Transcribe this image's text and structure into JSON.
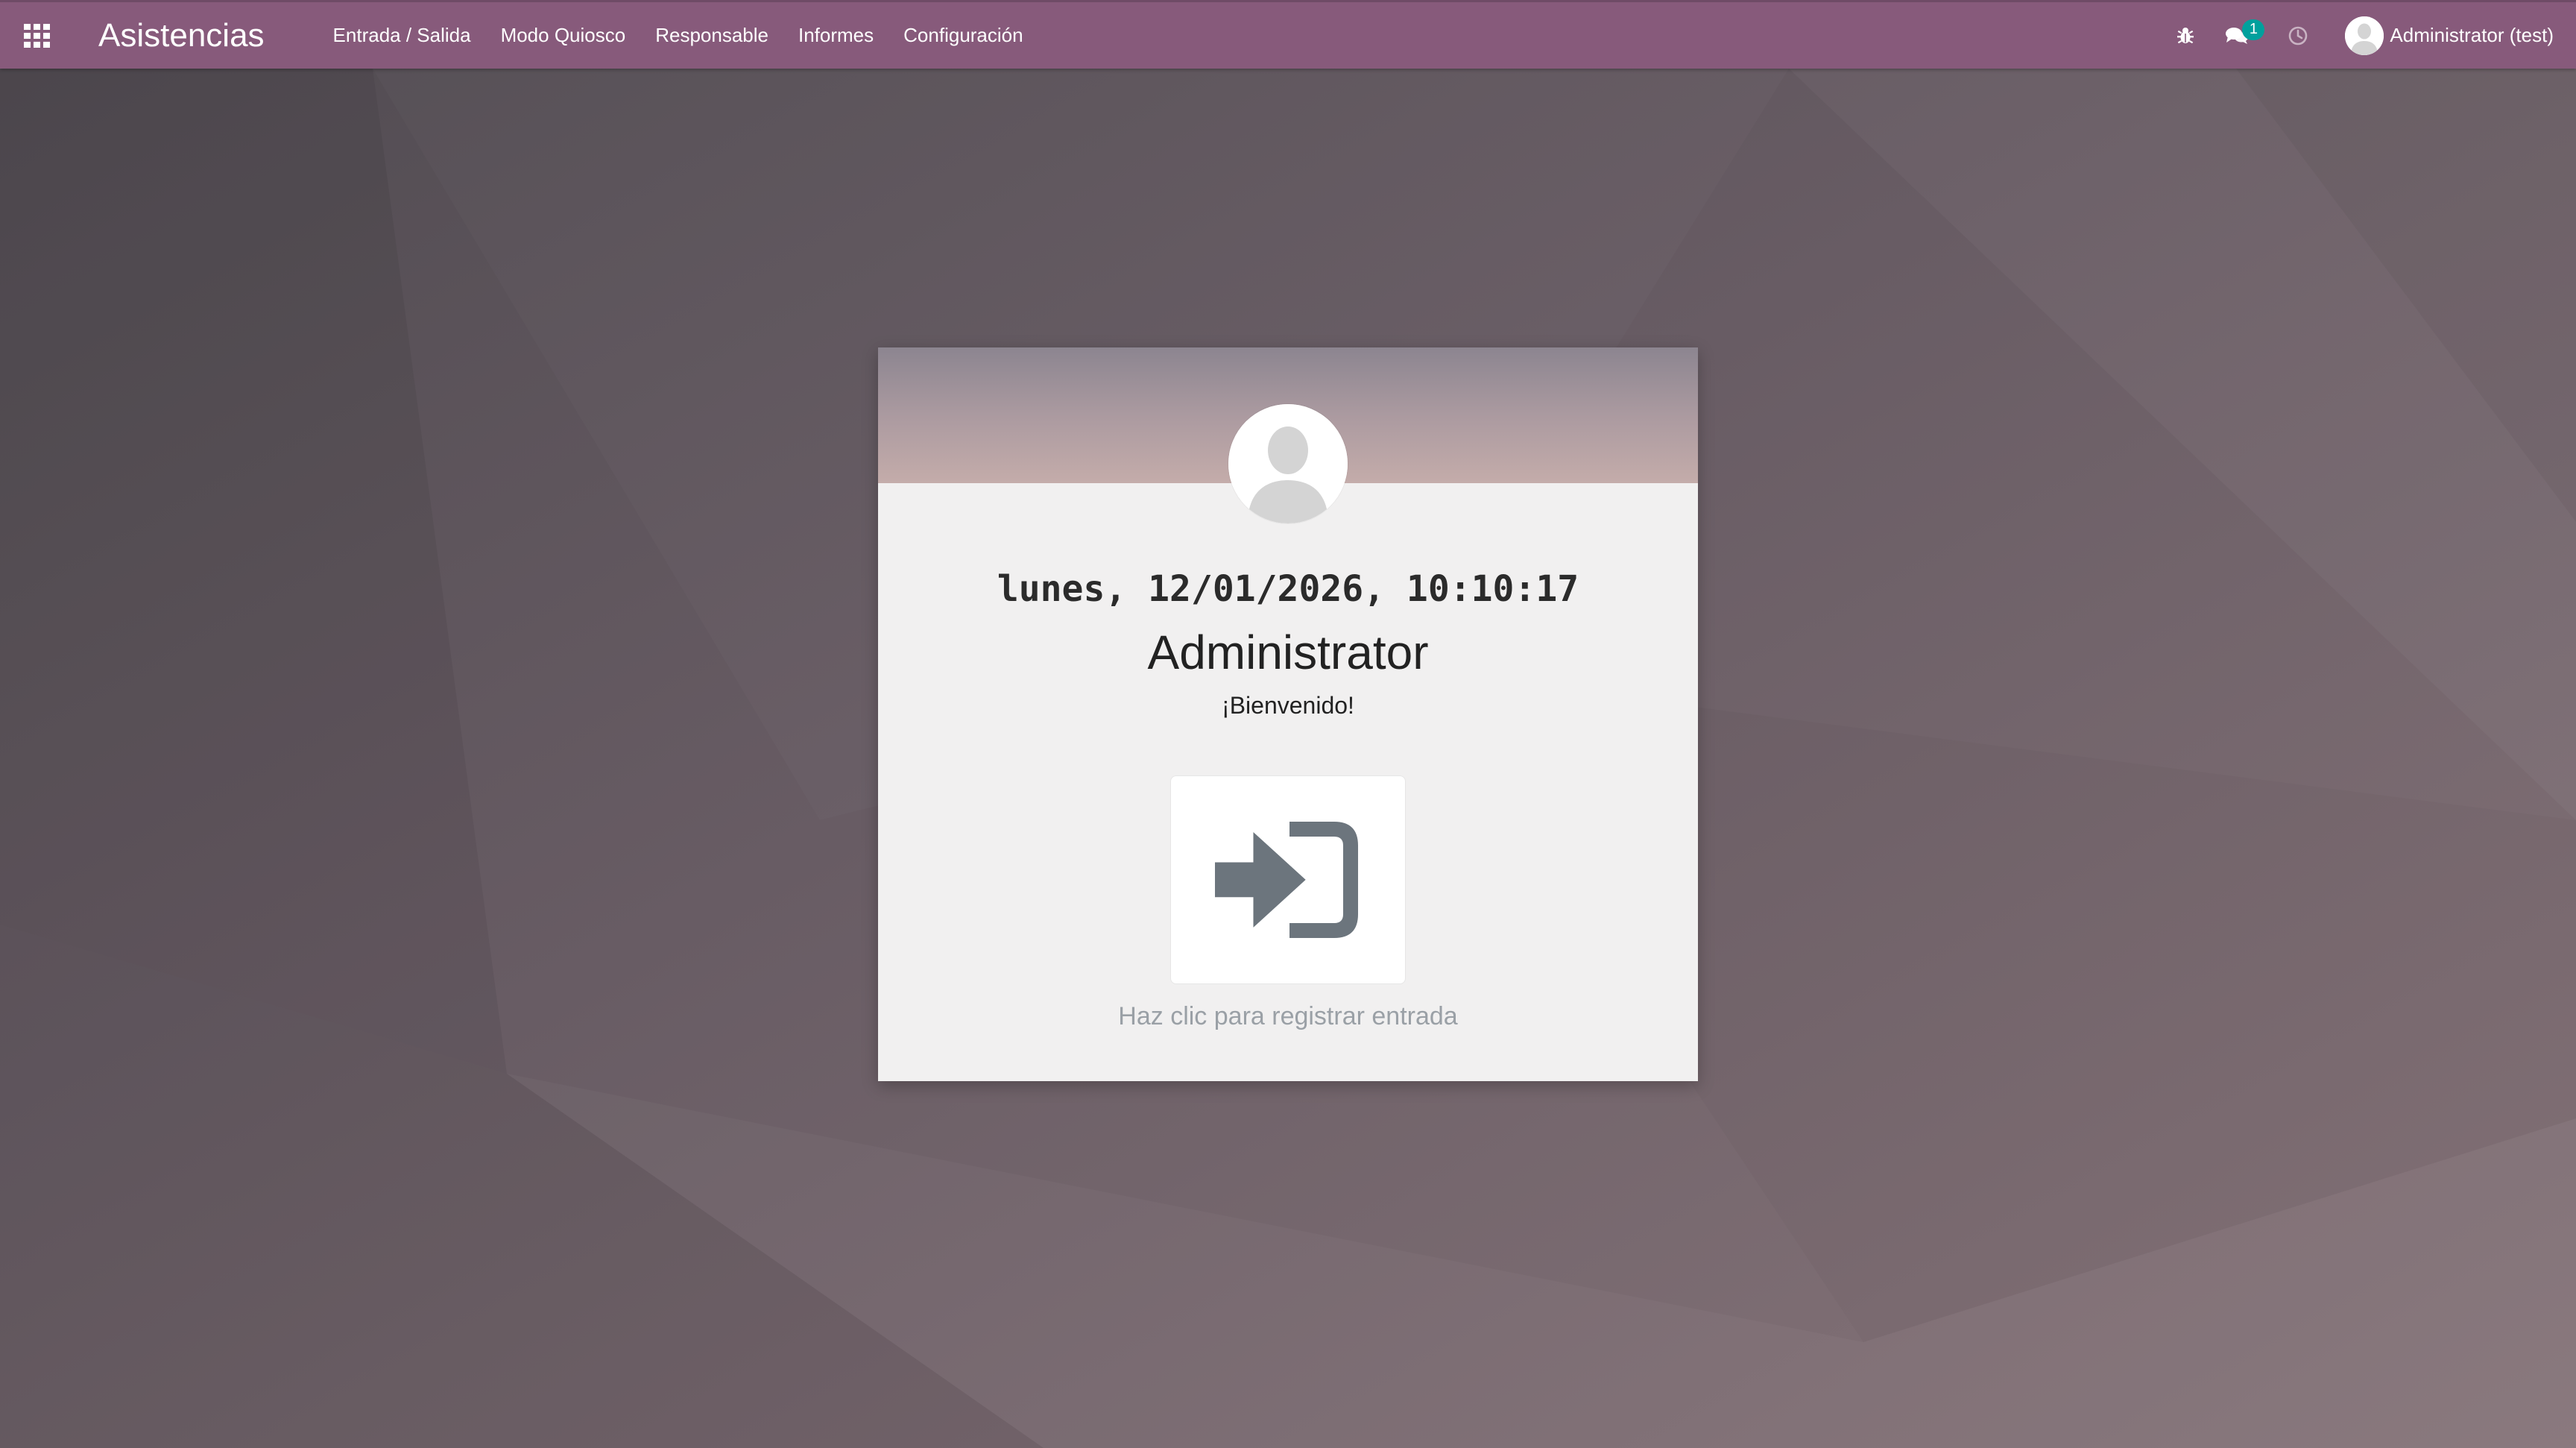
{
  "navbar": {
    "apps_icon": "apps-grid-icon",
    "app_title": "Asistencias",
    "menu": [
      {
        "label": "Entrada / Salida"
      },
      {
        "label": "Modo Quiosco"
      },
      {
        "label": "Responsable"
      },
      {
        "label": "Informes"
      },
      {
        "label": "Configuración"
      }
    ],
    "systray": {
      "debug_icon": "bug-icon",
      "messaging_icon": "chat-bubbles-icon",
      "messaging_count": "1",
      "activity_icon": "clock-icon",
      "user_name": "Administrator (test)"
    }
  },
  "card": {
    "datetime": "lunes, 12/01/2026, 10:10:17",
    "employee_name": "Administrator",
    "welcome": "¡Bienvenido!",
    "checkin_icon": "sign-in-icon",
    "hint": "Haz clic para registrar entrada"
  },
  "colors": {
    "navbar": "#875a7b",
    "badge": "#00a09d",
    "card_background": "#f1f0f0",
    "checkin_icon": "#6c757d",
    "hint_text": "#9aa0a6"
  }
}
